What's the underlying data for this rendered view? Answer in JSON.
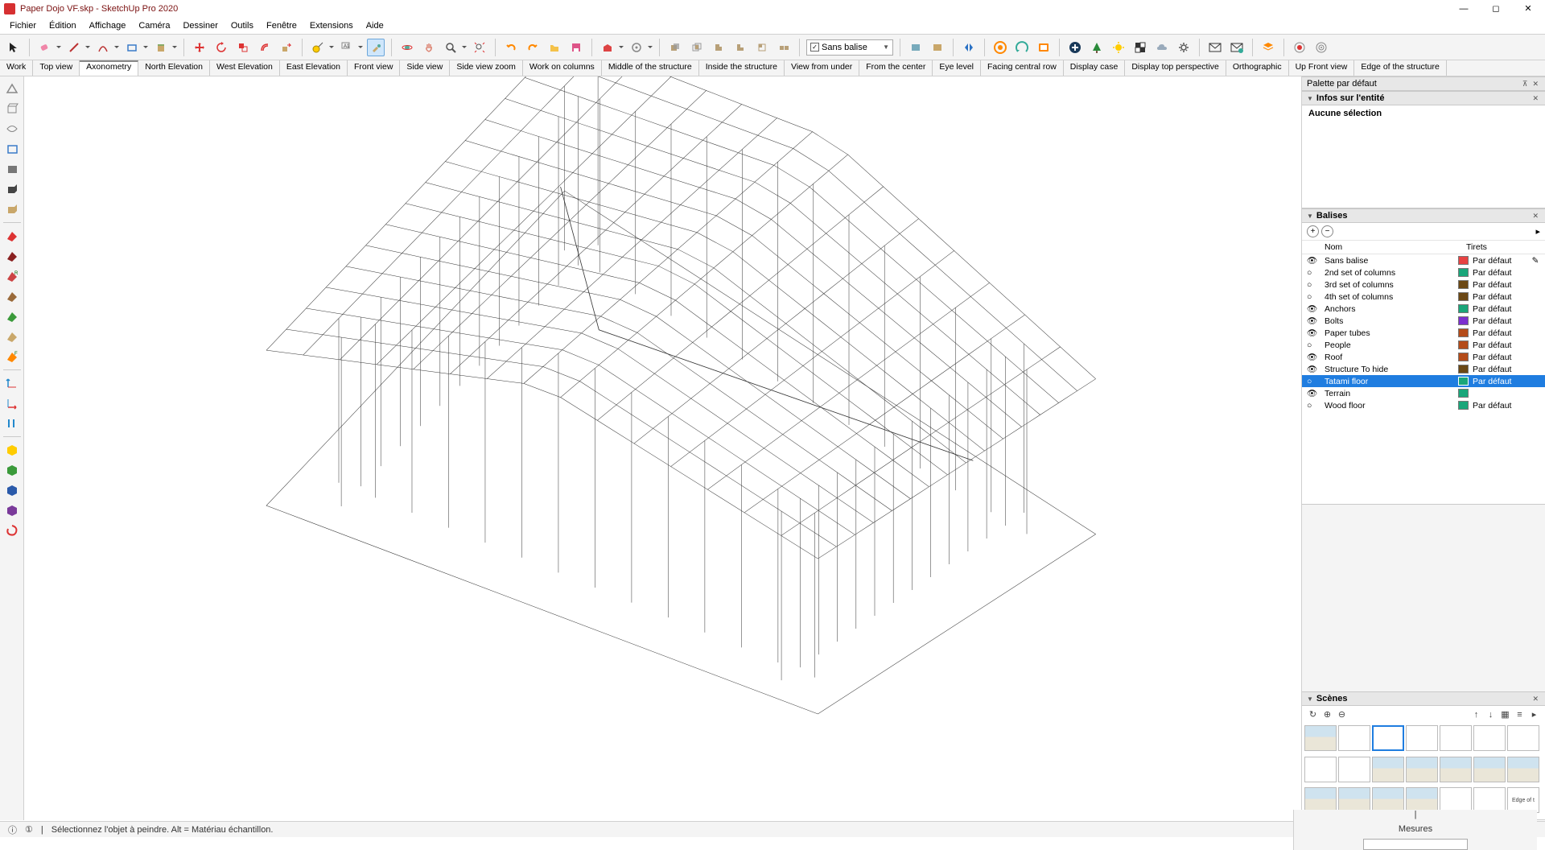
{
  "title": "Paper Dojo VF.skp - SketchUp Pro 2020",
  "menus": [
    "Fichier",
    "Édition",
    "Affichage",
    "Caméra",
    "Dessiner",
    "Outils",
    "Fenêtre",
    "Extensions",
    "Aide"
  ],
  "tag_dropdown": {
    "checked": true,
    "label": "Sans balise"
  },
  "scene_tabs": [
    "Work",
    "Top view",
    "Axonometry",
    "North Elevation",
    "West Elevation",
    "East Elevation",
    "Front view",
    "Side view",
    "Side view zoom",
    "Work on columns",
    "Middle of the structure",
    "Inside the structure",
    "View from under",
    "From the center",
    "Eye level",
    "Facing central row",
    "Display case",
    "Display top perspective",
    "Orthographic",
    "Up Front view",
    "Edge of the structure"
  ],
  "active_scene_tab": "Axonometry",
  "panels": {
    "default_tray": "Palette par défaut",
    "entity_info": {
      "title": "Infos sur l'entité",
      "body": "Aucune sélection"
    },
    "tags": {
      "title": "Balises",
      "cols": {
        "name": "Nom",
        "dash": "Tirets"
      },
      "rows": [
        {
          "vis": "eye",
          "name": "Sans balise",
          "color": "#e74242",
          "dash": "Par défaut",
          "pen": true
        },
        {
          "vis": "off",
          "name": "2nd set of columns",
          "color": "#1aa67a",
          "dash": "Par défaut"
        },
        {
          "vis": "off",
          "name": "3rd set of columns",
          "color": "#6b4815",
          "dash": "Par défaut"
        },
        {
          "vis": "off",
          "name": "4th set of columns",
          "color": "#6b4815",
          "dash": "Par défaut"
        },
        {
          "vis": "eye",
          "name": "Anchors",
          "color": "#1aa67a",
          "dash": "Par défaut"
        },
        {
          "vis": "eye",
          "name": "Bolts",
          "color": "#7c2fcf",
          "dash": "Par défaut"
        },
        {
          "vis": "eye",
          "name": "Paper tubes",
          "color": "#b44b19",
          "dash": "Par défaut"
        },
        {
          "vis": "off",
          "name": "People",
          "color": "#b44b19",
          "dash": "Par défaut"
        },
        {
          "vis": "eye",
          "name": "Roof",
          "color": "#b44b19",
          "dash": "Par défaut"
        },
        {
          "vis": "eye",
          "name": "Structure To hide",
          "color": "#6b4815",
          "dash": "Par défaut"
        },
        {
          "vis": "off",
          "name": "Tatami floor",
          "color": "#1aa67a",
          "dash": "Par défaut",
          "selected": true
        },
        {
          "vis": "eye",
          "name": "Terrain",
          "color": "#1aa67a",
          "dash": ""
        },
        {
          "vis": "off",
          "name": "Wood floor",
          "color": "#1aa67a",
          "dash": "Par défaut"
        }
      ]
    },
    "scenes": {
      "title": "Scènes"
    }
  },
  "status": {
    "hint": "Sélectionnez l'objet à peindre. Alt = Matériau échantillon.",
    "measurements_label": "Mesures"
  }
}
